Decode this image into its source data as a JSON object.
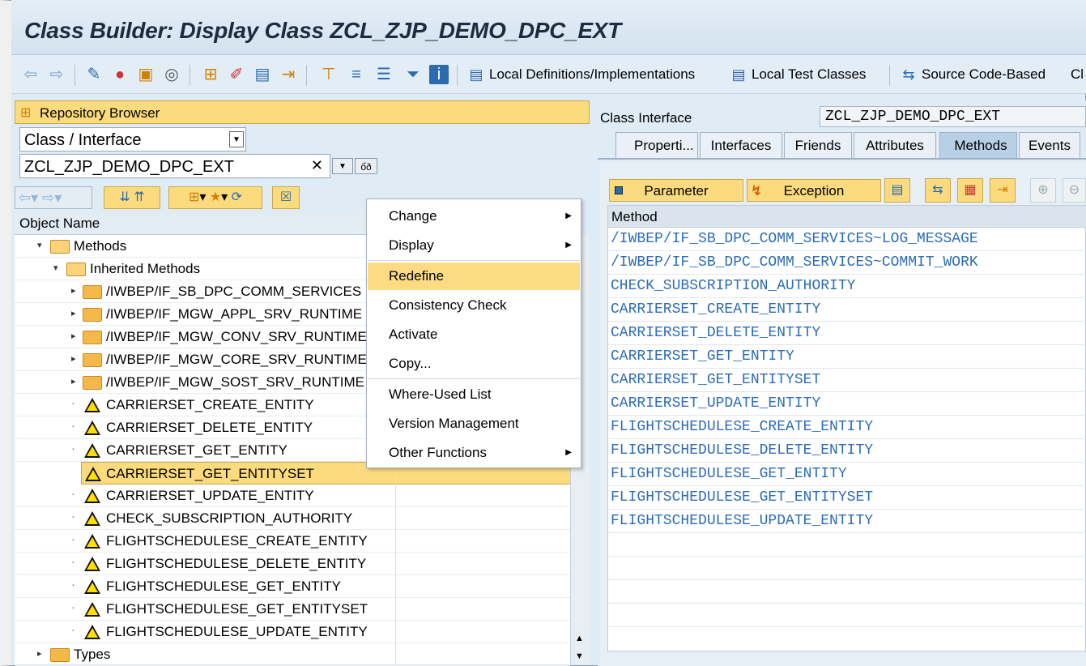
{
  "window": {
    "title": "Class Builder: Display Class ZCL_ZJP_DEMO_DPC_EXT"
  },
  "toolbar": {
    "local_defs": "Local Definitions/Implementations",
    "local_tests": "Local Test Classes",
    "source_code": "Source Code-Based",
    "overflow": "Cl"
  },
  "left": {
    "repo_title": "Repository Browser",
    "object_type": "Class / Interface",
    "object_name": "ZCL_ZJP_DEMO_DPC_EXT",
    "column_header": "Object Name",
    "tree": {
      "methods": "Methods",
      "inherited": "Inherited Methods",
      "folders": [
        "/IWBEP/IF_SB_DPC_COMM_SERVICES",
        "/IWBEP/IF_MGW_APPL_SRV_RUNTIME",
        "/IWBEP/IF_MGW_CONV_SRV_RUNTIME",
        "/IWBEP/IF_MGW_CORE_SRV_RUNTIME",
        "/IWBEP/IF_MGW_SOST_SRV_RUNTIME"
      ],
      "items": [
        "CARRIERSET_CREATE_ENTITY",
        "CARRIERSET_DELETE_ENTITY",
        "CARRIERSET_GET_ENTITY",
        "CARRIERSET_GET_ENTITYSET",
        "CARRIERSET_UPDATE_ENTITY",
        "CHECK_SUBSCRIPTION_AUTHORITY",
        "FLIGHTSCHEDULESE_CREATE_ENTITY",
        "FLIGHTSCHEDULESE_DELETE_ENTITY",
        "FLIGHTSCHEDULESE_GET_ENTITY",
        "FLIGHTSCHEDULESE_GET_ENTITYSET",
        "FLIGHTSCHEDULESE_UPDATE_ENTITY"
      ],
      "types": "Types"
    }
  },
  "context_menu": {
    "items": [
      "Change",
      "Display",
      "Redefine",
      "Consistency Check",
      "Activate",
      "Copy...",
      "Where-Used List",
      "Version Management",
      "Other Functions"
    ]
  },
  "right": {
    "class_interface_label": "Class Interface",
    "class_interface_value": "ZCL_ZJP_DEMO_DPC_EXT",
    "tabs": [
      "Properti...",
      "Interfaces",
      "Friends",
      "Attributes",
      "Methods",
      "Events"
    ],
    "parameter_btn": "Parameter",
    "exception_btn": "Exception",
    "method_header": "Method",
    "methods": [
      "/IWBEP/IF_SB_DPC_COMM_SERVICES~LOG_MESSAGE",
      "/IWBEP/IF_SB_DPC_COMM_SERVICES~COMMIT_WORK",
      "CHECK_SUBSCRIPTION_AUTHORITY",
      "CARRIERSET_CREATE_ENTITY",
      "CARRIERSET_DELETE_ENTITY",
      "CARRIERSET_GET_ENTITY",
      "CARRIERSET_GET_ENTITYSET",
      "CARRIERSET_UPDATE_ENTITY",
      "FLIGHTSCHEDULESE_CREATE_ENTITY",
      "FLIGHTSCHEDULESE_DELETE_ENTITY",
      "FLIGHTSCHEDULESE_GET_ENTITY",
      "FLIGHTSCHEDULESE_GET_ENTITYSET",
      "FLIGHTSCHEDULESE_UPDATE_ENTITY"
    ]
  }
}
